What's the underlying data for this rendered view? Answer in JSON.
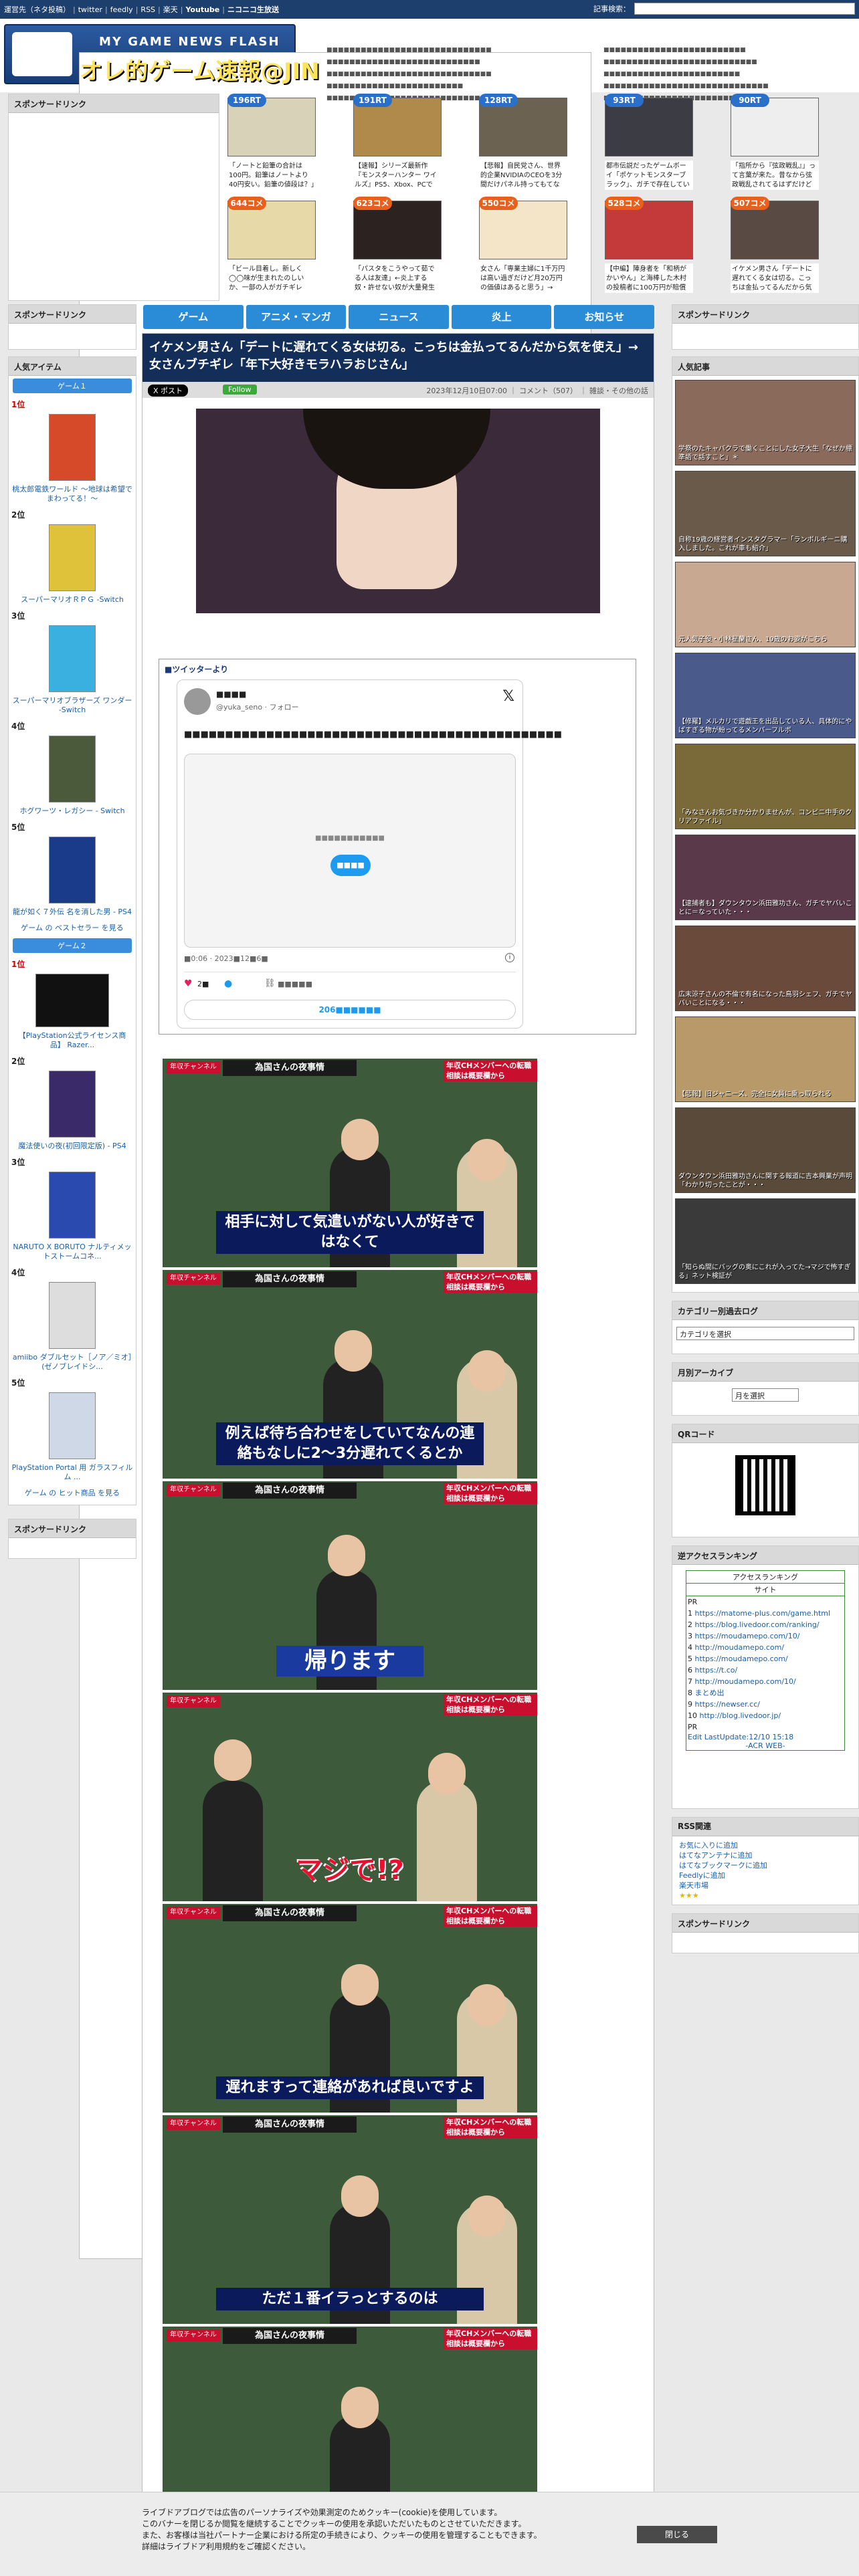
{
  "topbar": {
    "links": [
      "運営先（ネタ投稿）",
      "twitter",
      "feedly",
      "RSS",
      "楽天",
      "Youtube",
      "ニコニコ生放送"
    ],
    "search_label": "記事検索："
  },
  "header": {
    "logo_sub": "MY GAME NEWS FLASH",
    "logo_main": "オレ的ゲーム速報@JIN",
    "news_left": [
      "■■■■■■■■■■■■■■■■■■■■■■■■■■■■■",
      "■■■■■■■■■■■■■■■■■■■■■■■■■■■",
      "■■■■■■■■■■■■■■■■■■■■■■■■■■■■■",
      "■■■■■■■■■■■■■■■■■■■■■■■■",
      "■■■■■■■■■■■■■■■■■■■■■■■■■■■■"
    ],
    "news_right": [
      "■■■■■■■■■■■■■■■■■■■■■■■■■",
      "■■■■■■■■■■■■■■■■■■■■■■■■■■■",
      "■■■■■■■■■■■■■■■■■■■■■■■■",
      "■■■■■■■■■■■■■■■■■■■■■■■■■■■■■",
      "■■■■■■■■■■■■■■■■■■■■■■■"
    ]
  },
  "sponsored_label": "スポンサードリンク",
  "thumbs": [
    {
      "badge": "196RT",
      "color": "#2a6fc9",
      "caption": "「ノートと鉛筆の合計は100円。鉛筆はノートより40円安い。鉛筆の値段は？」←ガチ"
    },
    {
      "badge": "191RT",
      "color": "#2a6fc9",
      "caption": "【速報】シリーズ最新作『モンスターハンター ワイルズ』PS5、Xbox、PCで2025"
    },
    {
      "badge": "128RT",
      "color": "#2a6fc9",
      "caption": "【悲報】自民党さん、世界的企業NVIDIAのCEOを3分間だけパネル持ってもてなし"
    },
    {
      "badge": "93RT",
      "color": "#2a6fc9",
      "caption": "都市伝説だったゲームボーイ「ポケットモンスターブラック」、ガチで存在していた"
    },
    {
      "badge": "90RT",
      "color": "#2a6fc9",
      "caption": "「指所から『弦政戦乱』」って言葉が来た。昔なから弦政戦乱されてるはずだけど"
    },
    {
      "badge": "644コメ",
      "color": "#e8601c",
      "caption": "「ビール目着し。新しく◯◯味が生まれたのしいか、一部の人がガチギレ「健康ちゃ」「さ"
    },
    {
      "badge": "623コメ",
      "color": "#e8601c",
      "caption": "「パスタをこうやって茹でる人は友達」←炎上する奴・許せない奴が大量発生"
    },
    {
      "badge": "550コメ",
      "color": "#e8601c",
      "caption": "女さん「専業主婦に1千万円は高い過ぎだけど月20万円の価値はあると思う」→"
    },
    {
      "badge": "528コメ",
      "color": "#e8601c",
      "caption": "【中編】陣身者を「和柄がかいやん」と海棒した木村の投稿者に100万円が賠償命令"
    },
    {
      "badge": "507コメ",
      "color": "#e8601c",
      "caption": "イケメン男さん「デートに遅れてくる女は切る。こっちは金払ってるんだから気を使え」"
    }
  ],
  "nav": [
    "ゲーム",
    "アニメ・マンガ",
    "ニュース",
    "炎上",
    "お知らせ"
  ],
  "left": {
    "popular_title": "人気アイテム",
    "tab1": "ゲーム１",
    "tab2": "ゲーム２",
    "items1": [
      {
        "pos": "1位",
        "name": "桃太郎電鉄ワールド ～地球は希望でまわってる！～"
      },
      {
        "pos": "2位",
        "name": "スーパーマリオＲＰＧ -Switch"
      },
      {
        "pos": "3位",
        "name": "スーパーマリオブラザーズ ワンダー -Switch"
      },
      {
        "pos": "4位",
        "name": "ホグワーツ・レガシー - Switch"
      },
      {
        "pos": "5位",
        "name": "龍が如く７外伝 名を消した男 - PS4"
      }
    ],
    "more1": "ゲーム の ベストセラー を見る",
    "items2": [
      {
        "pos": "1位",
        "name": "【PlayStation公式ライセンス商品】 Razer..."
      },
      {
        "pos": "2位",
        "name": "魔法使いの夜(初回限定版) - PS4"
      },
      {
        "pos": "3位",
        "name": "NARUTO X BORUTO ナルティメットストームコネ..."
      },
      {
        "pos": "4位",
        "name": "amiibo ダブルセット［ノア／ミオ］(ゼノブレイドシ..."
      },
      {
        "pos": "5位",
        "name": "PlayStation Portal 用 ガラスフィルム ..."
      }
    ],
    "more2": "ゲーム の ヒット商品 を見る"
  },
  "article": {
    "title": "イケメン男さん「デートに遅れてくる女は切る。こっちは金払ってるんだから気を使え」→女さんブチギレ「年下大好きモラハラおじさん」",
    "x_label": "X ポスト",
    "follow_label": "Follow",
    "meta": "2023年12月10日07:00 ｜ コメント（507） ｜ 雑談・その他の話",
    "twitter_heading": "■ツイッターより",
    "tweet_name": "■■■■",
    "tweet_handle": "@yuka_seno · フォロー",
    "tweet_text": "■■■■■■■■■■■■■■■■■■■■■■■■■■■■■■■■■■■■■■■■■■■■■■",
    "tweet_media_text": "■■■■■■■■■■■",
    "tweet_media_btn": "■■■■",
    "tweet_time": "■0:06 · 2023■12■6■",
    "tweet_likes": "2■",
    "tweet_reply": "■■■■■",
    "tweet_read": "206■■■■■■"
  },
  "shots": [
    {
      "sub": "相手に対して気遣いがない人が好きではなくて",
      "tag1": "年収チャンネル",
      "tag2": "為国さんの夜事情",
      "tag3": "年収CHメンバーへの転職相談は概要欄から"
    },
    {
      "sub": "例えば待ち合わせをしていてなんの連絡もなしに2〜3分遅れてくるとか",
      "tag1": "年収チャンネル",
      "tag2": "為国さんの夜事情",
      "tag3": "年収CHメンバーへの転職相談は概要欄から"
    },
    {
      "sub": "帰ります",
      "tag1": "年収チャンネル",
      "tag2": "為国さんの夜事情",
      "tag3": "年収CHメンバーへの転職相談は概要欄から"
    },
    {
      "sub": "マジで!?",
      "tag1": "年収チャンネル",
      "tag2": "",
      "tag3": "年収CHメンバーへの転職相談は概要欄から"
    },
    {
      "sub": "遅れますって連絡があれば良いですよ",
      "tag1": "年収チャンネル",
      "tag2": "為国さんの夜事情",
      "tag3": "年収CHメンバーへの転職相談は概要欄から"
    },
    {
      "sub": "ただ１番イラっとするのは",
      "tag1": "年収チャンネル",
      "tag2": "為国さんの夜事情",
      "tag3": "年収CHメンバーへの転職相談は概要欄から"
    },
    {
      "sub": "",
      "tag1": "年収チャンネル",
      "tag2": "為国さんの夜事情",
      "tag3": "年収CHメンバーへの転職相談は概要欄から"
    }
  ],
  "right": {
    "popular_title": "人気記事",
    "popular": [
      "学祭のたキャバクラで働くことにした女子大生「なぜか標準語で話すこと」＊",
      "自称19歳の経営者インスタグラマー「ランボルギーニ購入しました。これが車も紹介」",
      "元人気子役・小林星蘭さん、19歳のお姿がこちら",
      "【修羅】メルカリで遊戯王を出品している人、具体的にやばすぎる物が紛ってるメンバーフルボ",
      "「みなさんお気づきか分かりませんが、コンビニ中手のクリアファイル」",
      "【逮捕者も】ダウンタウン浜田雅功さん、ガチでヤバいことに＝なっていた・・・",
      "広末涼子さんの不倫で有名になった鳥羽シェフ、ガチでヤバいことになる・・・",
      "【悲報】旧ジャニーズ、完全に女員に乗っ取られる",
      "ダウンタウン浜田雅功さんに関する報道に吉本興業が声明「わかり切ったことが・・・",
      "「知らぬ間にバッグの奥にこれが入ってた→マジで怖すぎる」ネット検証が"
    ],
    "category_title": "カテゴリー別過去ログ",
    "category_select": "カテゴリを選択",
    "monthly_title": "月別アーカイブ",
    "monthly_select": "月を選択",
    "qr_title": "QRコード",
    "ranking_title": "逆アクセスランキング",
    "ranking_head": "アクセスランキング",
    "ranking_site": "サイト",
    "ranking": [
      {
        "n": "PR",
        "url": ""
      },
      {
        "n": "1",
        "url": "https://matome-plus.com/game.html"
      },
      {
        "n": "2",
        "url": "https://blog.livedoor.com/ranking/"
      },
      {
        "n": "3",
        "url": "https://moudamepo.com/10/"
      },
      {
        "n": "4",
        "url": "http://moudamepo.com/"
      },
      {
        "n": "5",
        "url": "https://moudamepo.com/"
      },
      {
        "n": "6",
        "url": "https://t.co/"
      },
      {
        "n": "7",
        "url": "http://moudamepo.com/10/"
      },
      {
        "n": "8",
        "url": "まとめ出"
      },
      {
        "n": "9",
        "url": "https://newser.cc/"
      },
      {
        "n": "10",
        "url": "http://blog.livedoor.jp/"
      },
      {
        "n": "PR",
        "url": ""
      }
    ],
    "ranking_foot": "Edit LastUpdate:12/10 15:18",
    "ranking_acr": "-ACR WEB-",
    "rss_title": "RSS関連",
    "rss": [
      "お気に入りに追加",
      "はてなアンテナに追加",
      "はてなブックマークに追加",
      "Feedlyに追加",
      "楽天市場"
    ]
  },
  "cookie": {
    "lines": [
      "ライブドアブログでは広告のパーソナライズや効果測定のためクッキー(cookie)を使用しています。",
      "このバナーを閉じるか閲覧を継続することでクッキーの使用を承認いただいたものとさせていただきます。",
      "また、お客様は当社パートナー企業における所定の手続きにより、クッキーの使用を管理することもできます。",
      "詳細はライブドア利用規約をご確認ください。"
    ],
    "close": "閉じる"
  }
}
